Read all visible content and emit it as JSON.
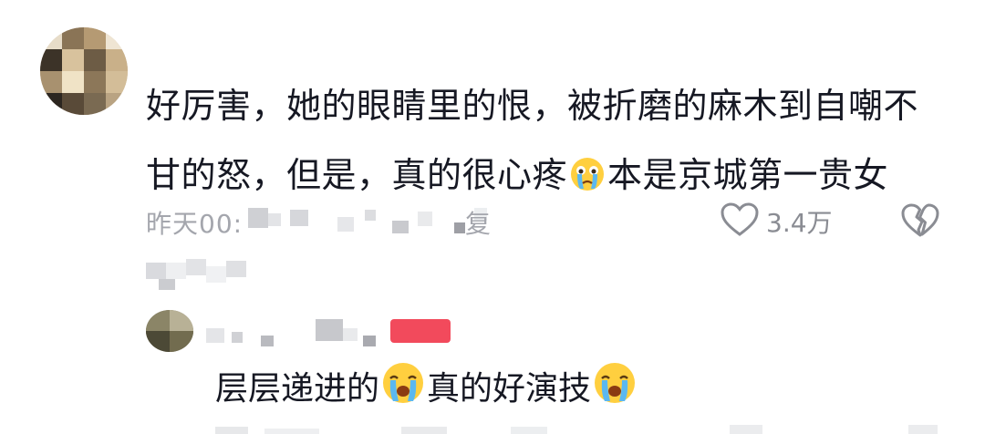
{
  "comment": {
    "line1": "好厉害，她的眼睛里的恨，被折磨的麻木到自嘲不",
    "line2_a": "甘的怒，但是，真的很心疼",
    "line2_b": "本是京城第一贵女",
    "time": "昨天00:",
    "reply_label": "复",
    "like_count": "3.4万"
  },
  "reply": {
    "text_a": "层层递进的",
    "text_b": "真的好演技"
  },
  "icons": {
    "crying_emoji": "crying-face",
    "like": "heart-outline",
    "dislike": "broken-heart"
  },
  "colors": {
    "text": "#161823",
    "meta": "#a4a6ad",
    "badge": "#f24a5c"
  }
}
